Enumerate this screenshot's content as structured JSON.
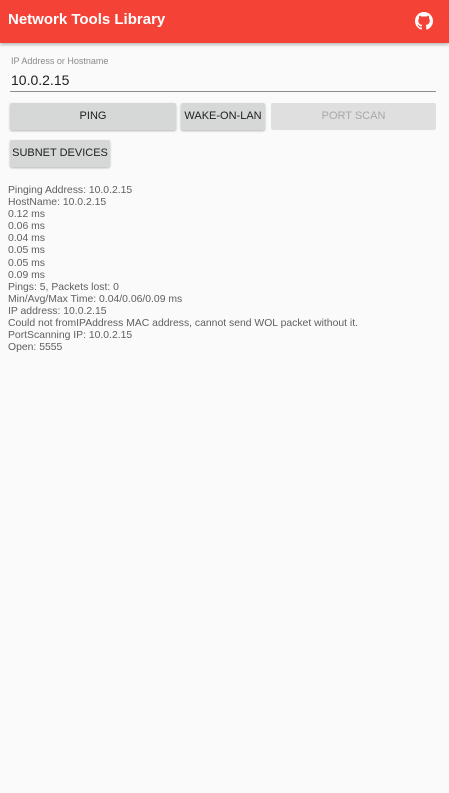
{
  "app_bar": {
    "title": "Network Tools Library",
    "color": "#f44336",
    "github_icon": "github-icon"
  },
  "ip_field": {
    "label": "IP Address or Hostname",
    "value": "10.0.2.15"
  },
  "buttons": {
    "ping": "PING",
    "wake_on_lan": "WAKE-ON-LAN",
    "port_scan": "PORT SCAN",
    "subnet_devices": "SUBNET DEVICES"
  },
  "output_lines": [
    "Pinging Address: 10.0.2.15",
    "HostName: 10.0.2.15",
    "0.12 ms",
    "0.06 ms",
    "0.04 ms",
    "0.05 ms",
    "0.05 ms",
    "0.09 ms",
    "Pings: 5, Packets lost: 0",
    "Min/Avg/Max Time: 0.04/0.06/0.09 ms",
    "IP address: 10.0.2.15",
    "Could not fromIPAddress MAC address, cannot send WOL packet without it.",
    "PortScanning IP: 10.0.2.15",
    "Open: 5555"
  ]
}
